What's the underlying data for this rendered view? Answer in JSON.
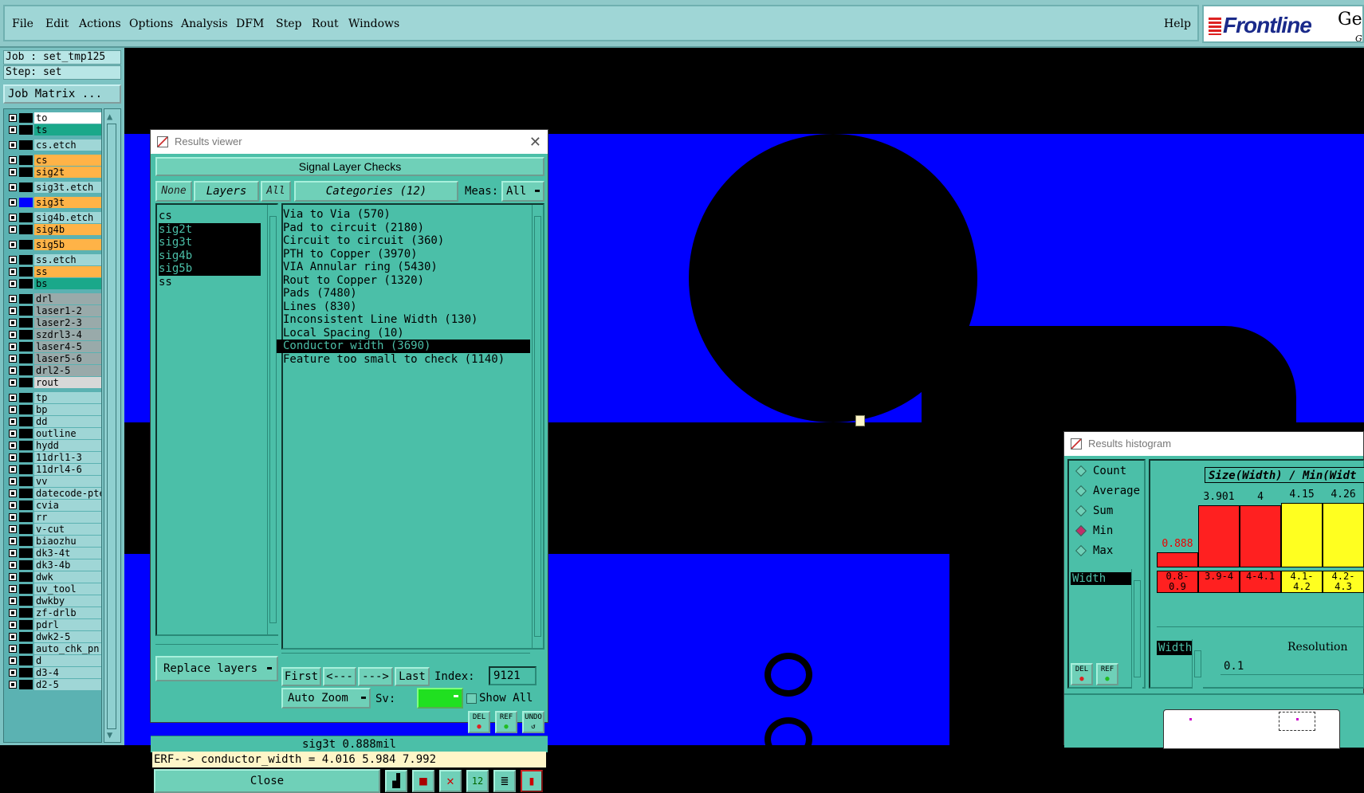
{
  "menubar": {
    "items": [
      "File",
      "Edit",
      "Actions",
      "Options",
      "Analysis",
      "DFM",
      "Step",
      "Rout",
      "Windows"
    ],
    "help": "Help",
    "logo_text": "Frontline",
    "logo_tail": "Ger",
    "logo_sub": "G"
  },
  "left_panel": {
    "job": "Job : set_tmp125",
    "step": "Step: set",
    "job_matrix": "Job Matrix ...",
    "layers": [
      {
        "name": "to",
        "color": "#ffffff"
      },
      {
        "name": "ts",
        "color": "#1aa88a"
      },
      {
        "name": "cs.etch",
        "color": "#9fd6d6"
      },
      {
        "name": "cs",
        "color": "#ffb347"
      },
      {
        "name": "sig2t",
        "color": "#ffb347"
      },
      {
        "name": "sig3t.etch",
        "color": "#9fd6d6"
      },
      {
        "name": "sig3t",
        "color": "#ffb347"
      },
      {
        "name": "sig4b.etch",
        "color": "#9fd6d6"
      },
      {
        "name": "sig4b",
        "color": "#ffb347"
      },
      {
        "name": "sig5b",
        "color": "#ffb347"
      },
      {
        "name": "ss.etch",
        "color": "#9fd6d6"
      },
      {
        "name": "ss",
        "color": "#ffb347"
      },
      {
        "name": "bs",
        "color": "#1aa88a"
      },
      {
        "name": "drl",
        "color": "#9aa"
      },
      {
        "name": "laser1-2",
        "color": "#9aa"
      },
      {
        "name": "laser2-3",
        "color": "#9aa"
      },
      {
        "name": "szdrl3-4",
        "color": "#9aa"
      },
      {
        "name": "laser4-5",
        "color": "#9aa"
      },
      {
        "name": "laser5-6",
        "color": "#9aa"
      },
      {
        "name": "drl2-5",
        "color": "#9aa"
      },
      {
        "name": "rout",
        "color": "#d8d8d8"
      },
      {
        "name": "tp",
        "color": "#9fd6d6"
      },
      {
        "name": "bp",
        "color": "#9fd6d6"
      },
      {
        "name": "dd",
        "color": "#9fd6d6"
      },
      {
        "name": "outline",
        "color": "#9fd6d6"
      },
      {
        "name": "hydd",
        "color": "#9fd6d6"
      },
      {
        "name": "11drl1-3",
        "color": "#9fd6d6"
      },
      {
        "name": "11drl4-6",
        "color": "#9fd6d6"
      },
      {
        "name": "vv",
        "color": "#9fd6d6"
      },
      {
        "name": "datecode-pte",
        "color": "#9fd6d6"
      },
      {
        "name": "cvia",
        "color": "#9fd6d6"
      },
      {
        "name": "rr",
        "color": "#9fd6d6"
      },
      {
        "name": "v-cut",
        "color": "#9fd6d6"
      },
      {
        "name": "biaozhu",
        "color": "#9fd6d6"
      },
      {
        "name": "dk3-4t",
        "color": "#9fd6d6"
      },
      {
        "name": "dk3-4b",
        "color": "#9fd6d6"
      },
      {
        "name": "dwk",
        "color": "#9fd6d6"
      },
      {
        "name": "uv_tool",
        "color": "#9fd6d6"
      },
      {
        "name": "dwkby",
        "color": "#9fd6d6"
      },
      {
        "name": "zf-drlb",
        "color": "#9fd6d6"
      },
      {
        "name": "pdrl",
        "color": "#9fd6d6"
      },
      {
        "name": "dwk2-5",
        "color": "#9fd6d6"
      },
      {
        "name": "auto_chk_pn",
        "color": "#9fd6d6"
      },
      {
        "name": "d",
        "color": "#9fd6d6"
      },
      {
        "name": "d3-4",
        "color": "#9fd6d6"
      },
      {
        "name": "d2-5",
        "color": "#9fd6d6"
      }
    ]
  },
  "results_viewer": {
    "window_title": "Results viewer",
    "header": "Signal Layer Checks",
    "none_btn": "None",
    "layers_btn": "Layers",
    "all_btn": "All",
    "categories_btn": "Categories (12)",
    "meas_label": "Meas:",
    "meas_value": "All",
    "layer_items": [
      {
        "name": "cs",
        "selected": false
      },
      {
        "name": "sig2t",
        "selected": true
      },
      {
        "name": "sig3t",
        "selected": true
      },
      {
        "name": "sig4b",
        "selected": true
      },
      {
        "name": "sig5b",
        "selected": true
      },
      {
        "name": "ss",
        "selected": false
      }
    ],
    "category_items": [
      {
        "text": "Via to Via (570)",
        "selected": false
      },
      {
        "text": "Pad to circuit (2180)",
        "selected": false
      },
      {
        "text": "Circuit to circuit (360)",
        "selected": false
      },
      {
        "text": "PTH to Copper (3970)",
        "selected": false
      },
      {
        "text": "VIA Annular ring (5430)",
        "selected": false
      },
      {
        "text": "Rout to Copper (1320)",
        "selected": false
      },
      {
        "text": "Pads (7480)",
        "selected": false
      },
      {
        "text": "Lines (830)",
        "selected": false
      },
      {
        "text": "Inconsistent Line Width (130)",
        "selected": false
      },
      {
        "text": "Local Spacing (10)",
        "selected": false
      },
      {
        "text": "Conductor width (3690)",
        "selected": true
      },
      {
        "text": "Feature too small to check (1140)",
        "selected": false
      }
    ],
    "first_btn": "First",
    "prev_btn": "<---",
    "next_btn": "--->",
    "last_btn": "Last",
    "index_label": "Index:",
    "index_value": "9121",
    "auto_zoom": "Auto Zoom",
    "sv_label": "Sv:",
    "show_all": "Show All",
    "replace_layers": "Replace layers",
    "del_btn": "DEL",
    "ref_btn": "REF",
    "undo_btn": "UNDO",
    "status_line": "sig3t 0.888mil",
    "erf_line": "ERF--> conductor_width = 4.016 5.984 7.992",
    "close_btn": "Close"
  },
  "histogram": {
    "window_title": "Results histogram",
    "radios": [
      {
        "label": "Count",
        "on": false
      },
      {
        "label": "Average",
        "on": false
      },
      {
        "label": "Sum",
        "on": false
      },
      {
        "label": "Min",
        "on": true
      },
      {
        "label": "Max",
        "on": false
      }
    ],
    "field_label": "Width",
    "chart_title": "Size(Width) / Min(Widt",
    "bars": [
      {
        "value": "0.888",
        "bin": "0.8-0.9",
        "color": "#ff2020",
        "level": 0.22
      },
      {
        "value": "3.901",
        "bin": "3.9-4",
        "color": "#ff2020",
        "level": 0.92
      },
      {
        "value": "4",
        "bin": "4-4.1",
        "color": "#ff2020",
        "level": 0.92
      },
      {
        "value": "4.15",
        "bin": "4.1-4.2",
        "color": "#ffff20",
        "level": 0.95
      },
      {
        "value": "4.26",
        "bin": "4.2-4.3",
        "color": "#ffff20",
        "level": 0.95
      }
    ],
    "width_label2": "Width",
    "resolution_label": "Resolution",
    "resolution_value": "0.1",
    "del_btn": "DEL",
    "ref_btn": "REF"
  }
}
